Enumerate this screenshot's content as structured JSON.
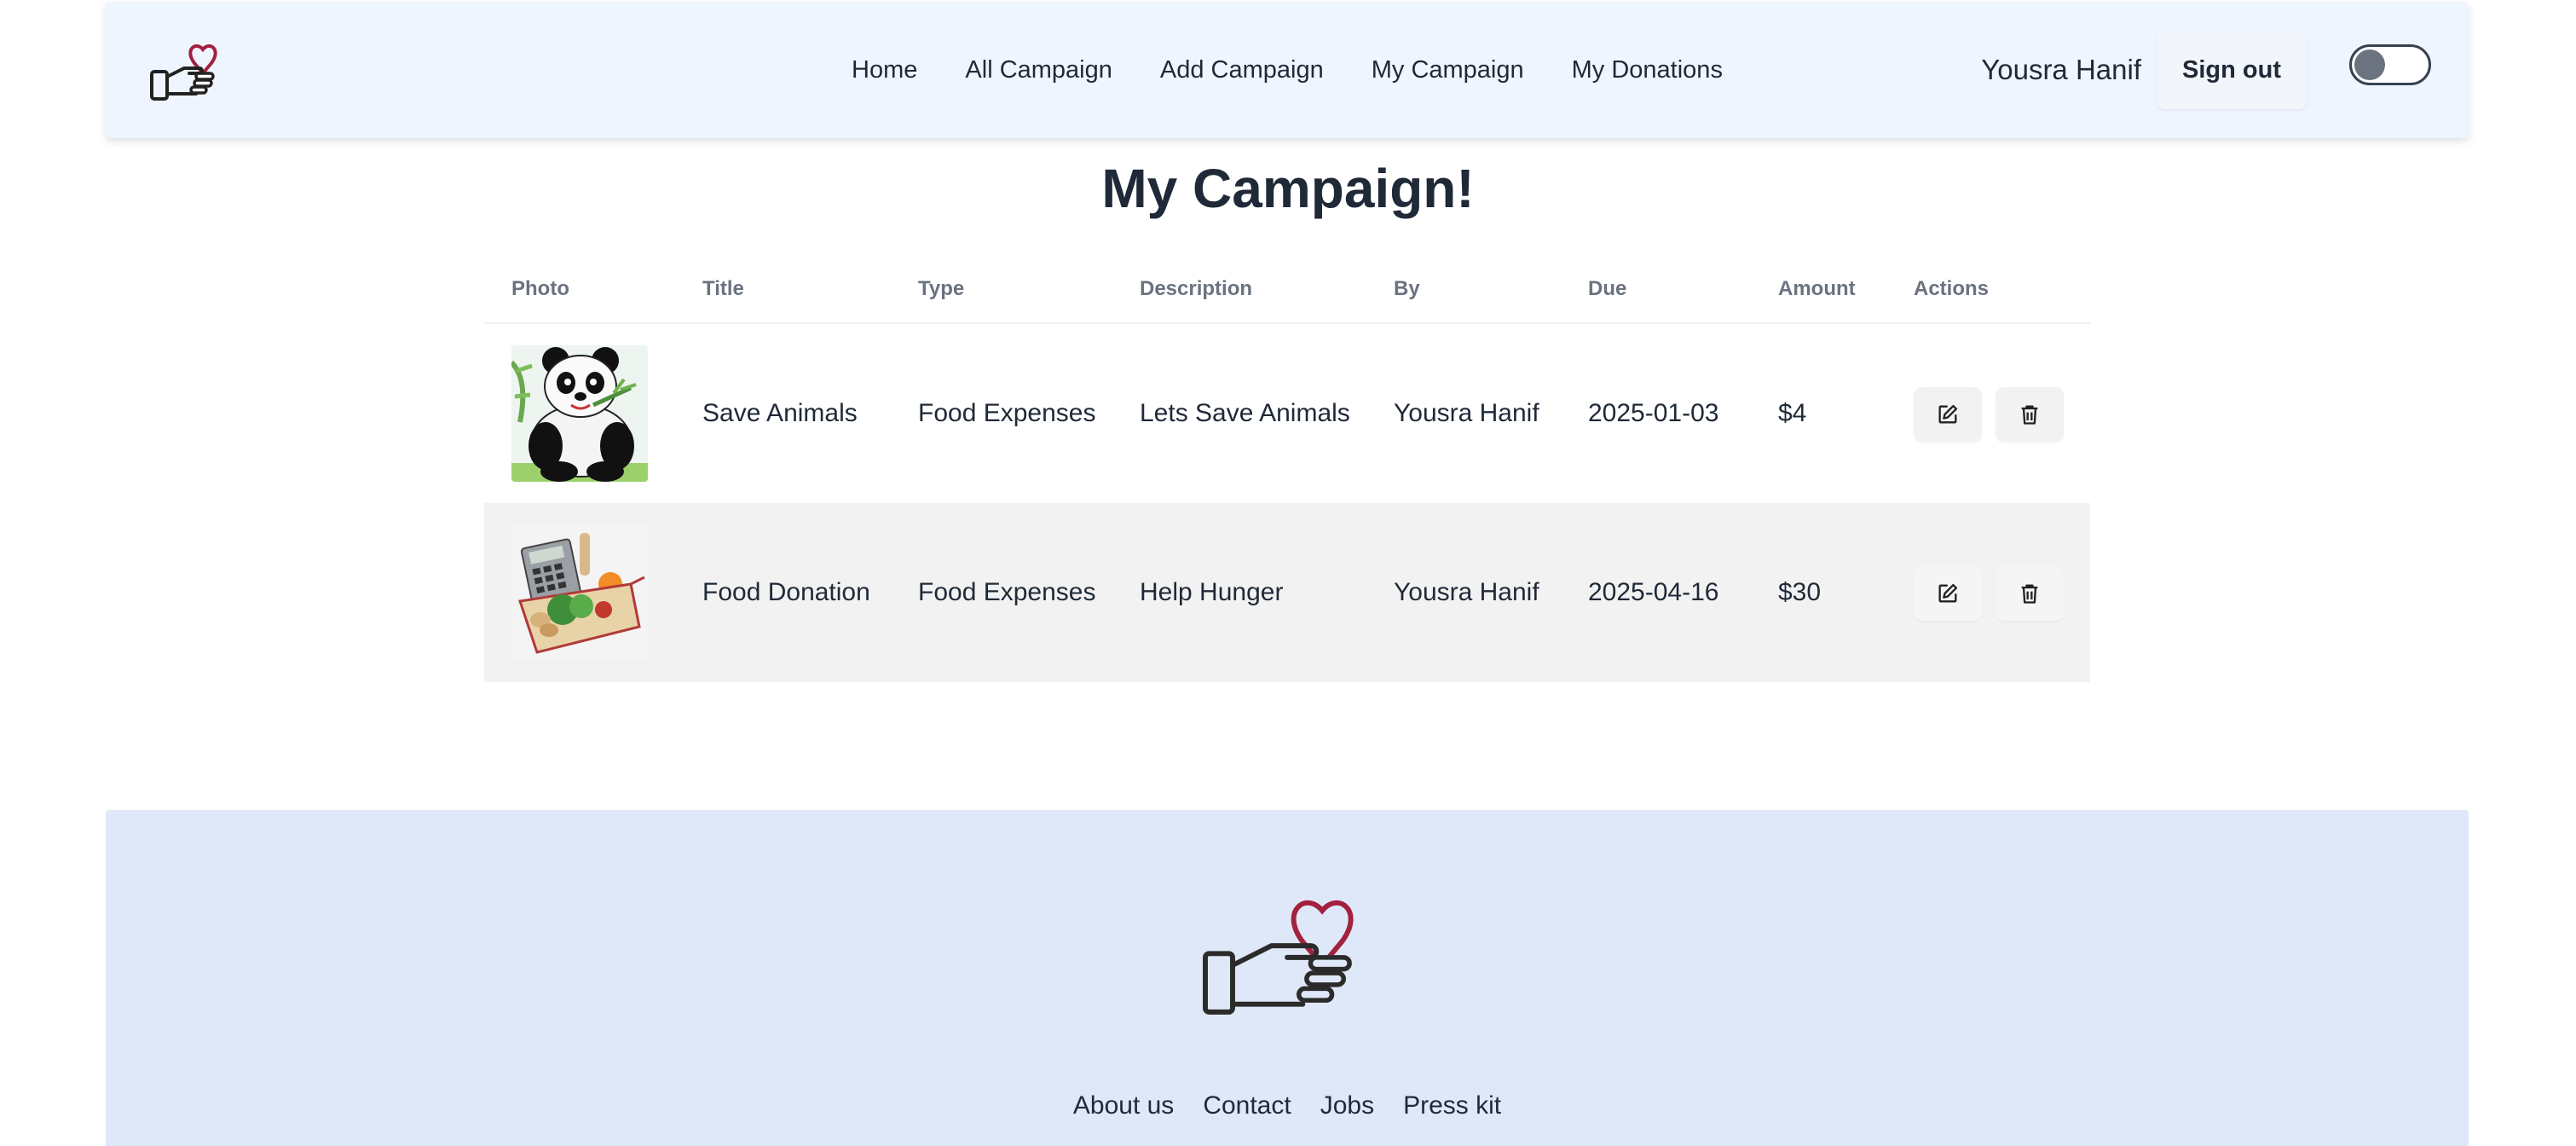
{
  "nav": {
    "links": [
      "Home",
      "All Campaign",
      "Add Campaign",
      "My Campaign",
      "My Donations"
    ],
    "user_name": "Yousra Hanif",
    "signout_label": "Sign out",
    "theme_toggle_on": false
  },
  "page": {
    "title": "My Campaign!"
  },
  "table": {
    "headers": [
      "Photo",
      "Title",
      "Type",
      "Description",
      "By",
      "Due",
      "Amount",
      "Actions"
    ],
    "rows": [
      {
        "photo_icon": "panda-photo",
        "title": "Save Animals",
        "type": "Food Expenses",
        "description": "Lets Save Animals",
        "by": "Yousra Hanif",
        "due": "2025-01-03",
        "amount": "$4"
      },
      {
        "photo_icon": "grocery-basket-photo",
        "title": "Food Donation",
        "type": "Food Expenses",
        "description": "Help Hunger",
        "by": "Yousra Hanif",
        "due": "2025-04-16",
        "amount": "$30"
      }
    ]
  },
  "footer": {
    "links": [
      "About us",
      "Contact",
      "Jobs",
      "Press kit"
    ]
  },
  "colors": {
    "navbar_bg": "#eff5fe",
    "footer_bg": "#dfe8f9",
    "heart": "#a3213f",
    "text": "#1f2937",
    "row_alt": "#f2f2f2"
  }
}
